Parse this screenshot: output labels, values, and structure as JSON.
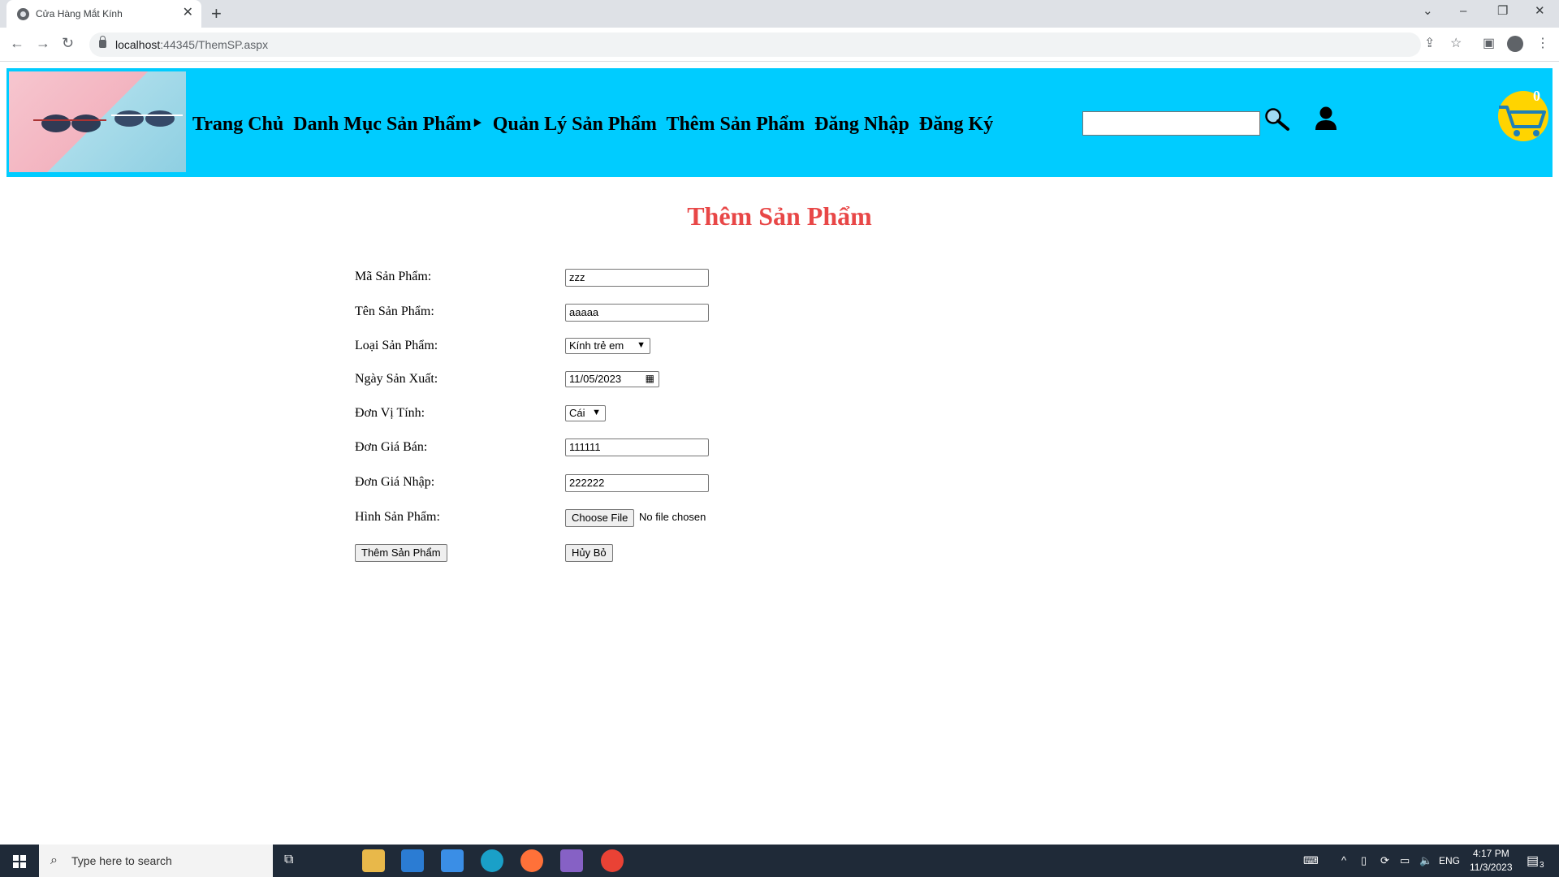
{
  "browser": {
    "tab_title": "Cửa Hàng Mắt Kính",
    "url_host": "localhost",
    "url_rest": ":44345/ThemSP.aspx"
  },
  "site": {
    "nav": [
      "Trang Chủ",
      "Danh Mục Sản Phẩm‣",
      "Quản Lý Sản Phẩm",
      "Thêm Sản Phẩm",
      "Đăng Nhập",
      "Đăng Ký"
    ],
    "cart_count": "0"
  },
  "page": {
    "title": "Thêm Sản Phẩm"
  },
  "form": {
    "ma_label": "Mã Sản Phẩm:",
    "ma_value": "zzz",
    "ten_label": "Tên Sản Phẩm:",
    "ten_value": "aaaaa",
    "loai_label": "Loại Sản Phẩm:",
    "loai_value": "Kính trẻ em",
    "ngay_label": "Ngày Sản Xuất:",
    "ngay_value": "11/05/2023",
    "dvt_label": "Đơn Vị Tính:",
    "dvt_value": "Cái",
    "giaban_label": "Đơn Giá Bán:",
    "giaban_value": "111111",
    "gianhap_label": "Đơn Giá Nhập:",
    "gianhap_value": "222222",
    "hinh_label": "Hình Sản Phẩm:",
    "choose_file": "Choose File",
    "no_file": "No file chosen",
    "submit_label": "Thêm Sản Phẩm",
    "cancel_label": "Hủy Bỏ"
  },
  "taskbar": {
    "search_placeholder": "Type here to search",
    "lang": "ENG",
    "time": "4:17 PM",
    "date": "11/3/2023",
    "notifications": "3"
  }
}
